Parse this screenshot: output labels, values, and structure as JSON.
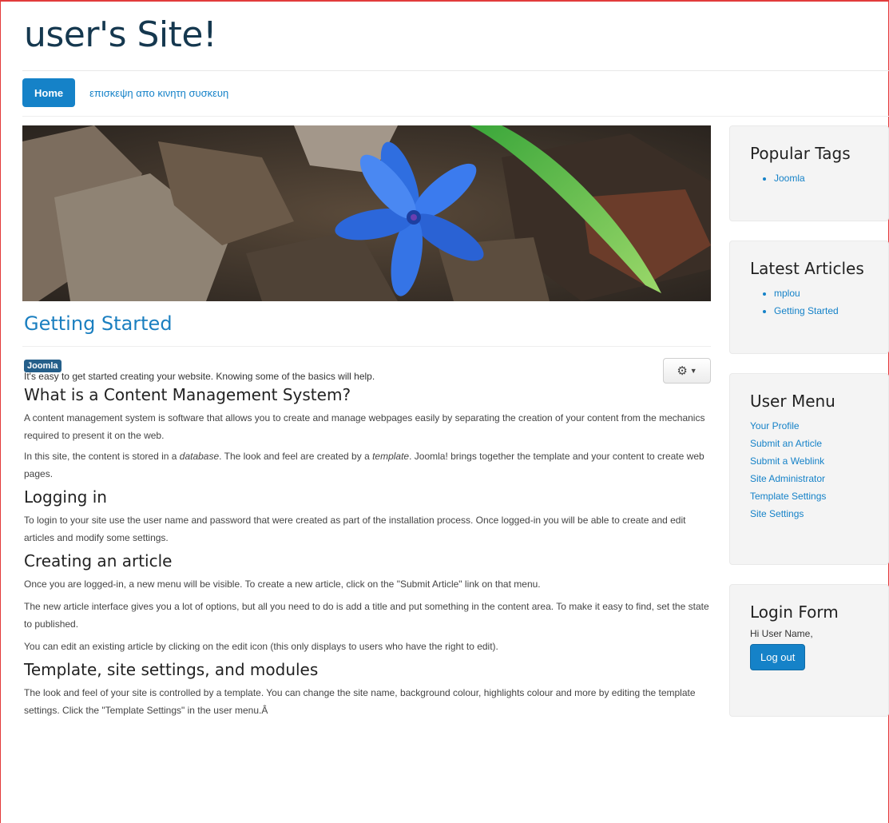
{
  "site": {
    "title": "user's Site!"
  },
  "nav": {
    "home": "Home",
    "link": "επισκεψη απο κινητη συσκευη"
  },
  "article": {
    "title": "Getting Started",
    "tag": "Joomla",
    "intro": "It's easy to get started creating your website. Knowing some of the basics will help.",
    "sections": [
      {
        "heading": "What is a Content Management System?",
        "paras": [
          "A content management system is software that allows you to create and manage webpages easily by separating the creation of your content from the mechanics required to present it on the web.",
          [
            "In this site, the content is stored in a ",
            "database",
            ". The look and feel are created by a ",
            "template",
            ". Joomla! brings together the template and your content to create web pages."
          ]
        ]
      },
      {
        "heading": "Logging in",
        "paras": [
          "To login to your site use the user name and password that were created as part of the installation process. Once logged-in you will be able to create and edit articles and modify some settings."
        ]
      },
      {
        "heading": "Creating an article",
        "paras": [
          "Once you are logged-in, a new menu will be visible. To create a new article, click on the \"Submit Article\" link on that menu.",
          "The new article interface gives you a lot of options, but all you need to do is add a title and put something in the content area. To make it easy to find, set the state to published.",
          "You can edit an existing article by clicking on the edit icon (this only displays to users who have the right to edit)."
        ]
      },
      {
        "heading": "Template, site settings, and modules",
        "paras": [
          "The look and feel of your site is controlled by a template. You can change the site name, background colour, highlights colour and more by editing the template settings. Click the \"Template Settings\" in the user menu.Â"
        ]
      }
    ]
  },
  "sidebar": {
    "popular_tags": {
      "title": "Popular Tags",
      "items": [
        "Joomla"
      ]
    },
    "latest_articles": {
      "title": "Latest Articles",
      "items": [
        "mplou",
        "Getting Started"
      ]
    },
    "user_menu": {
      "title": "User Menu",
      "items": [
        "Your Profile",
        "Submit an Article",
        "Submit a Weblink",
        "Site Administrator",
        "Template Settings",
        "Site Settings"
      ]
    },
    "login_form": {
      "title": "Login Form",
      "greeting": "Hi User Name,",
      "button": "Log out"
    }
  },
  "icons": {
    "options": "gear-icon",
    "options_caret": "caret-down-icon"
  },
  "colors": {
    "accent": "#1582c8",
    "title": "#15384f",
    "frame": "#e23b3b"
  }
}
